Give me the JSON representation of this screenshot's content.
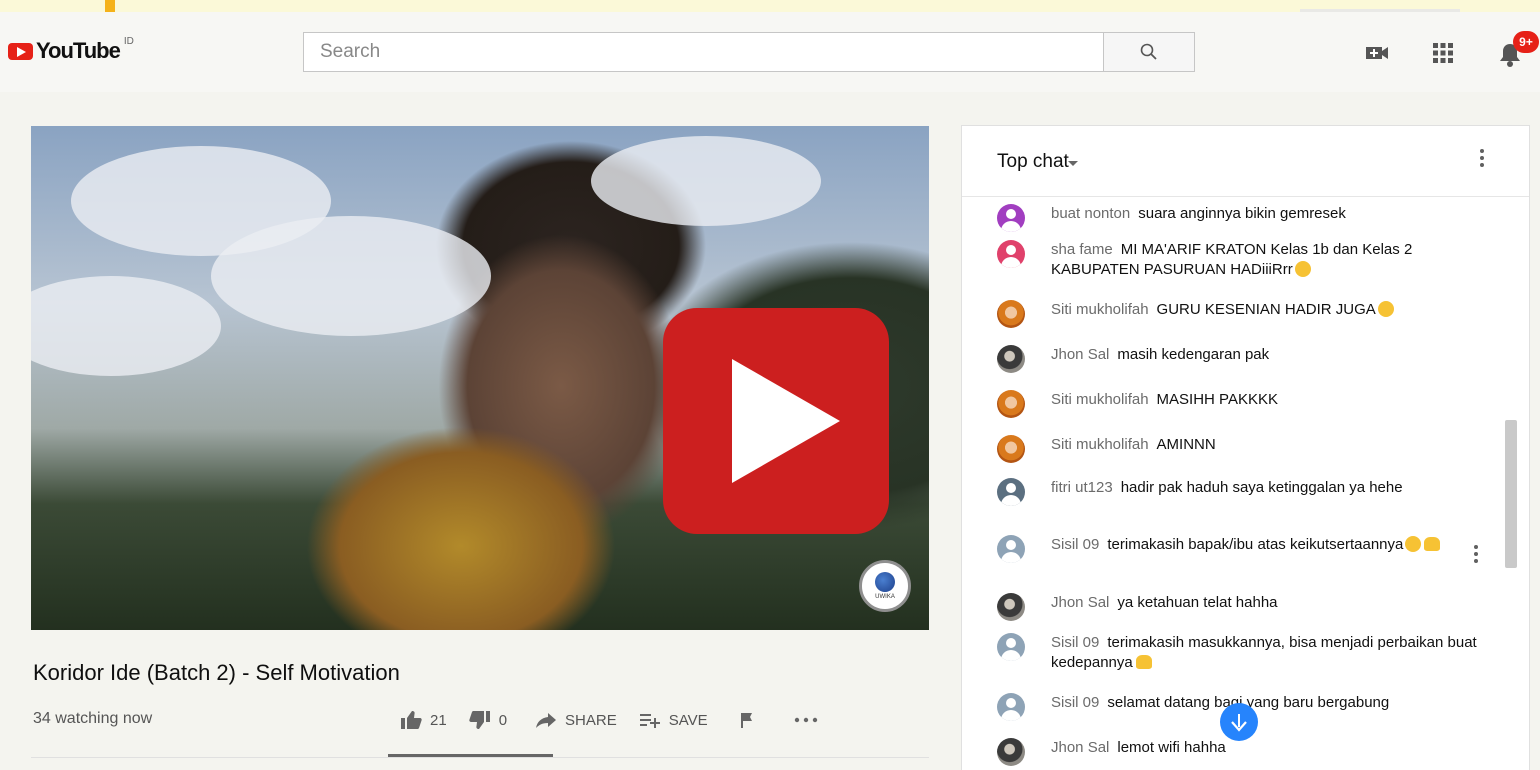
{
  "header": {
    "logo_text": "YouTube",
    "country_code": "ID",
    "search_placeholder": "Search",
    "notification_count": "9+"
  },
  "video": {
    "title": "Koridor Ide (Batch 2) - Self Motivation",
    "watching": "34 watching now",
    "watermark_text": "UWIKA",
    "actions": {
      "like_count": "21",
      "dislike_count": "0",
      "share_label": "SHARE",
      "save_label": "SAVE"
    }
  },
  "chat": {
    "title": "Top chat",
    "messages": [
      {
        "author": "buat nonton",
        "text": "suara anginnya bikin gemresek",
        "avatar": "purple"
      },
      {
        "author": "sha fame",
        "text": "MI MA'ARIF KRATON Kelas 1b dan Kelas 2 KABUPATEN PASURUAN HADiiiRrr",
        "avatar": "pink"
      },
      {
        "author": "Siti mukholifah",
        "text": "GURU KESENIAN HADIR JUGA",
        "avatar": "siti"
      },
      {
        "author": "Jhon Sal",
        "text": "masih kedengaran pak",
        "avatar": "jhon"
      },
      {
        "author": "Siti mukholifah",
        "text": "MASIHH PAKKKK",
        "avatar": "siti"
      },
      {
        "author": "Siti mukholifah",
        "text": "AMINNN",
        "avatar": "siti"
      },
      {
        "author": "fitri ut123",
        "text": "hadir pak haduh saya ketinggalan ya hehe",
        "avatar": "generic-dark"
      },
      {
        "author": "Sisil 09",
        "text": "terimakasih bapak/ibu atas keikutsertaannya",
        "avatar": "generic"
      },
      {
        "author": "Jhon Sal",
        "text": "ya ketahuan telat hahha",
        "avatar": "jhon"
      },
      {
        "author": "Sisil 09",
        "text": "terimakasih masukkannya, bisa menjadi perbaikan buat kedepannya",
        "avatar": "generic"
      },
      {
        "author": "Sisil 09",
        "text": "selamat datang bagi yang baru bergabung",
        "avatar": "generic"
      },
      {
        "author": "Jhon Sal",
        "text": "lemot wifi hahha",
        "avatar": "jhon"
      }
    ]
  },
  "colors": {
    "brand_red": "#e62117",
    "play_red": "#cc1f1f",
    "scroll_button_blue": "#2684fc"
  }
}
